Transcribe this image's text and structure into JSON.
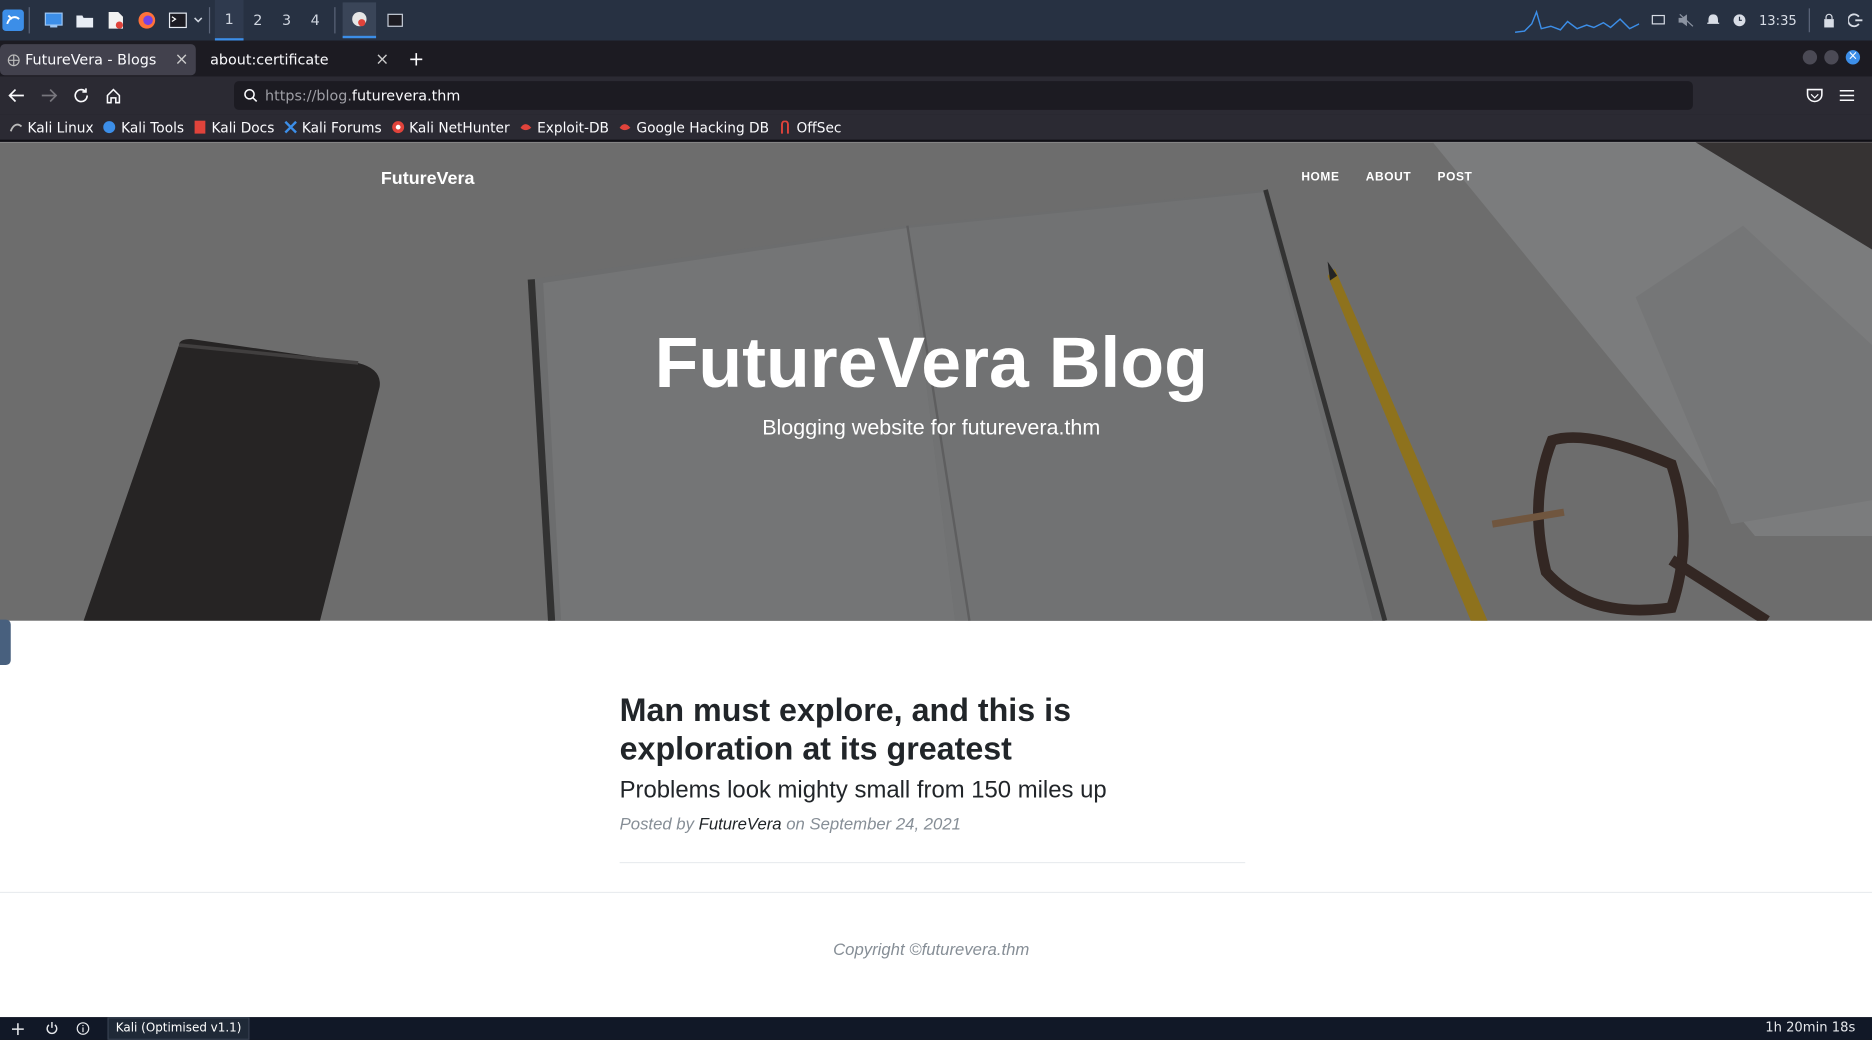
{
  "os_panel": {
    "workspaces": [
      "1",
      "2",
      "3",
      "4"
    ],
    "active_workspace": "1",
    "clock": "13:35",
    "icons": [
      "kali-menu-icon",
      "desktop-icon",
      "file-manager-icon",
      "text-editor-icon",
      "firefox-icon",
      "terminal-icon",
      "tools-badge-icon",
      "terminal-small-icon"
    ]
  },
  "browser": {
    "tabs": [
      {
        "title": "FutureVera - Blogs",
        "active": true
      },
      {
        "title": "about:certificate",
        "active": false
      }
    ],
    "url_scheme": "https://blog.",
    "url_host": "futurevera.thm",
    "bookmarks": [
      "Kali Linux",
      "Kali Tools",
      "Kali Docs",
      "Kali Forums",
      "Kali NetHunter",
      "Exploit-DB",
      "Google Hacking DB",
      "OffSec"
    ]
  },
  "site": {
    "brand": "FutureVera",
    "nav": [
      "HOME",
      "ABOUT",
      "POST"
    ],
    "hero_title": "FutureVera Blog",
    "hero_subtitle": "Blogging website for futurevera.thm",
    "post": {
      "title": "Man must explore, and this is exploration at its greatest",
      "subtitle": "Problems look mighty small from 150 miles up",
      "posted_by_prefix": "Posted by",
      "author": "FutureVera",
      "date_text": "on September 24, 2021"
    },
    "copyright": "Copyright ©futurevera.thm"
  },
  "vm_bar": {
    "task_label": "Kali (Optimised v1.1)",
    "session_time": "1h 20min 18s"
  },
  "colors": {
    "panel": "#273142",
    "accent": "#3c8ee8",
    "hero_overlay": "#6c6c6c"
  }
}
